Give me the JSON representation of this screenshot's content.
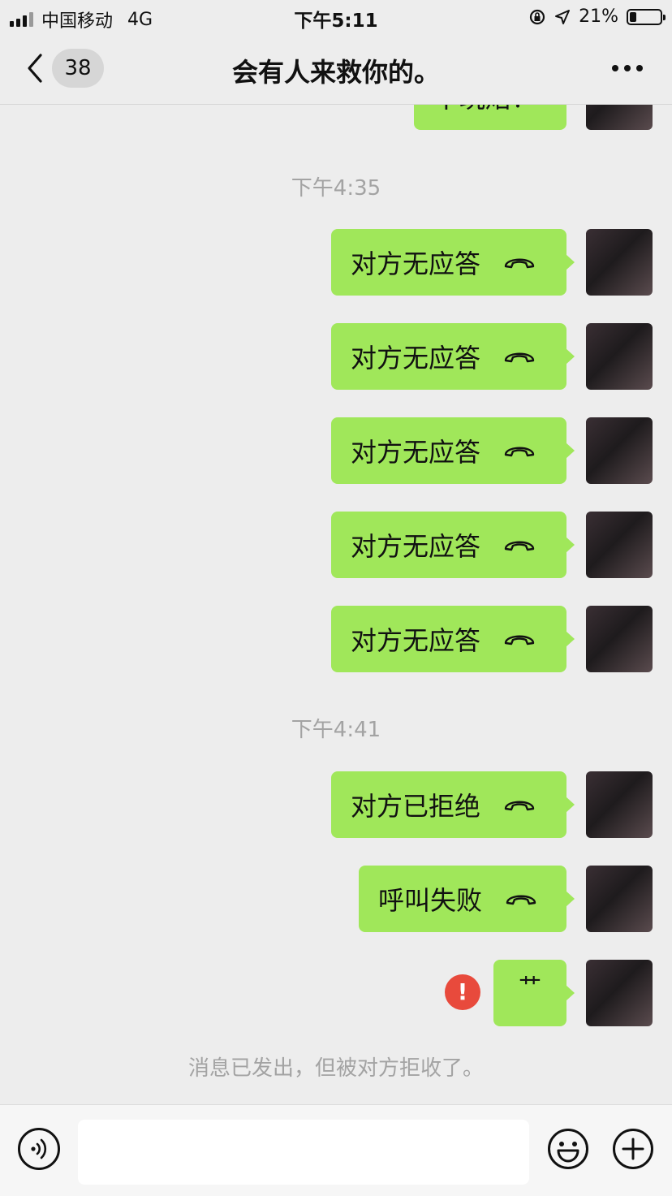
{
  "status_bar": {
    "carrier": "中国移动",
    "network": "4G",
    "time": "下午5:11",
    "battery": "21%",
    "battery_level": 0.21
  },
  "nav": {
    "unread_count": "38",
    "title": "会有人来救你的。"
  },
  "chat": {
    "partial_text": "干玩焙！",
    "time_1": "下午4:35",
    "time_2": "下午4:41",
    "calls": [
      {
        "text": "对方无应答"
      },
      {
        "text": "对方无应答"
      },
      {
        "text": "对方无应答"
      },
      {
        "text": "对方无应答"
      },
      {
        "text": "对方无应答"
      },
      {
        "text": "对方已拒绝"
      },
      {
        "text": "呼叫失败"
      }
    ],
    "last_message": "艹",
    "error_mark": "!",
    "system_message": "消息已发出，但被对方拒收了。"
  },
  "input_bar": {
    "value": "",
    "placeholder": ""
  },
  "colors": {
    "bubble": "#a0e75a",
    "error": "#e84a3c",
    "background": "#ededed"
  },
  "icons": [
    "signal-icon",
    "lock-rotation-icon",
    "location-icon",
    "battery-icon",
    "back-chevron-icon",
    "more-icon",
    "phone-hangup-icon",
    "error-icon",
    "voice-icon",
    "emoji-icon",
    "plus-icon"
  ]
}
